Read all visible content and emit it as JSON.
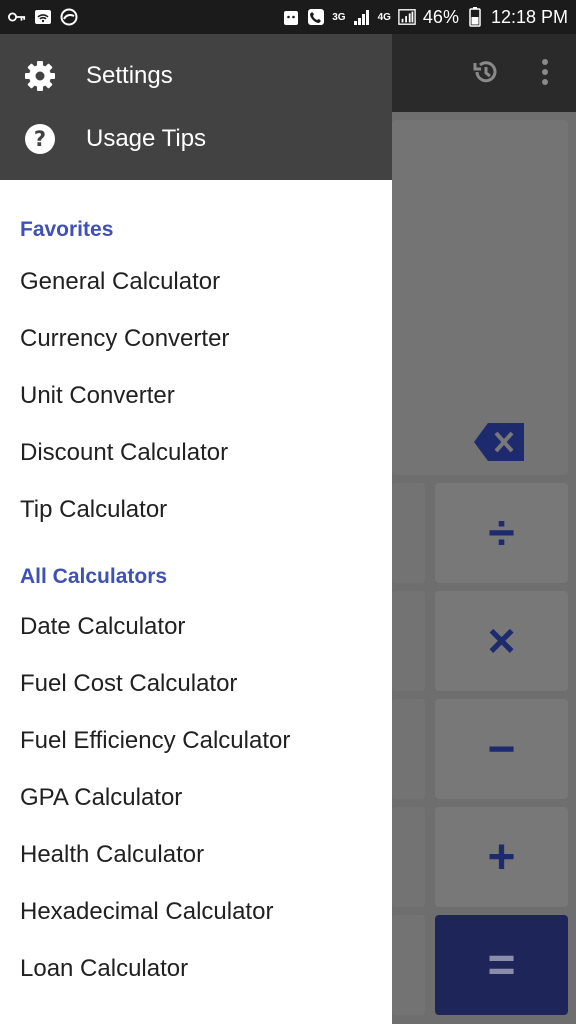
{
  "status_bar": {
    "left_icons": [
      "key-icon",
      "wifi-hotspot-icon",
      "sync-icon"
    ],
    "network_3g": "3G",
    "network_4g": "4G",
    "battery": "46%",
    "time": "12:18 PM"
  },
  "drawer": {
    "header_items": [
      {
        "label": "Settings",
        "icon": "gear-icon"
      },
      {
        "label": "Usage Tips",
        "icon": "help-icon"
      }
    ],
    "favorites_title": "Favorites",
    "favorites": [
      "General Calculator",
      "Currency Converter",
      "Unit Converter",
      "Discount Calculator",
      "Tip Calculator"
    ],
    "all_title": "All Calculators",
    "all": [
      "Date Calculator",
      "Fuel Cost Calculator",
      "Fuel Efficiency Calculator",
      "GPA Calculator",
      "Health Calculator",
      "Hexadecimal Calculator",
      "Loan Calculator"
    ]
  },
  "calculator": {
    "toolbar_icons": [
      "history-icon",
      "more-vert-icon"
    ],
    "keys": {
      "divide": "÷",
      "multiply": "×",
      "subtract": "−",
      "add": "+",
      "equals": "="
    }
  },
  "colors": {
    "accent": "#3f51b5",
    "drawer_header": "#424242",
    "operator_key_text": "#1e2a6e",
    "equals_key_bg": "#1e2659"
  }
}
